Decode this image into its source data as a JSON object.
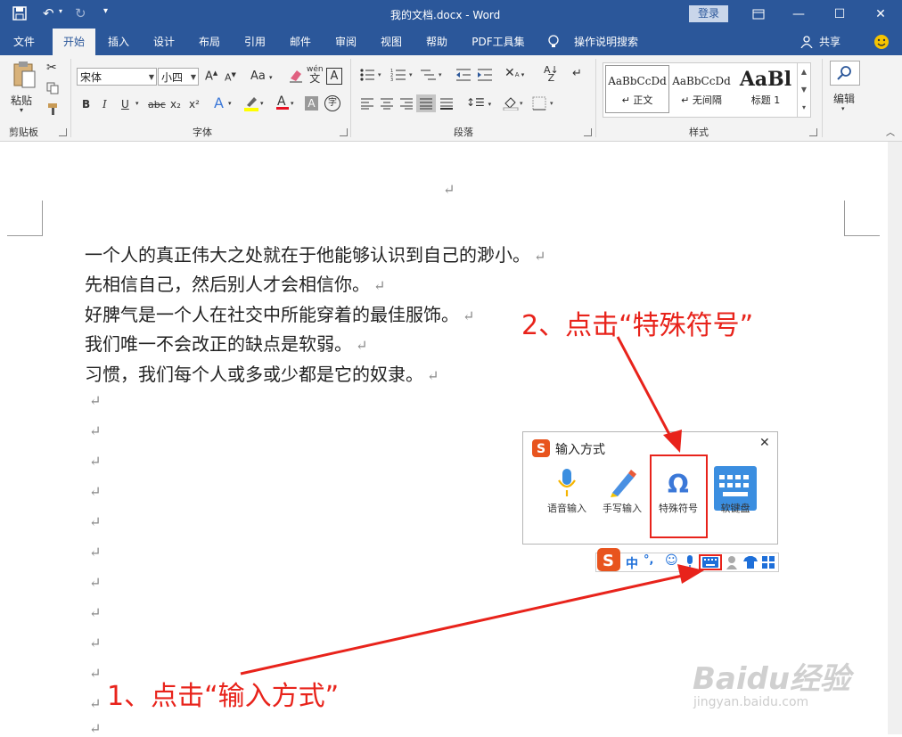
{
  "window": {
    "title": "我的文档.docx  -  Word",
    "login_label": "登录"
  },
  "menu_tabs": [
    "文件",
    "开始",
    "插入",
    "设计",
    "布局",
    "引用",
    "邮件",
    "审阅",
    "视图",
    "帮助",
    "PDF工具集",
    "操作说明搜索"
  ],
  "share_label": "共享",
  "ribbon": {
    "clipboard": {
      "paste_label": "粘贴",
      "group_label": "剪贴板"
    },
    "font": {
      "font_name": "宋体",
      "font_size": "小四",
      "group_label": "字体",
      "bold": "B",
      "italic": "I",
      "underline": "U",
      "strike": "abc",
      "sub": "x₂",
      "sup": "x²",
      "grow": "A",
      "shrink": "A",
      "case": "Aa",
      "pinyin": "wén",
      "border_char": "A"
    },
    "paragraph": {
      "group_label": "段落"
    },
    "styles": {
      "group_label": "样式",
      "items": [
        {
          "preview": "AaBbCcDd",
          "name": "↵ 正文"
        },
        {
          "preview": "AaBbCcDd",
          "name": "↵ 无间隔"
        },
        {
          "preview": "AaBl",
          "name": "标题 1"
        }
      ]
    },
    "editing": {
      "label": "编辑"
    }
  },
  "document": {
    "lines": [
      "一个人的真正伟大之处就在于他能够认识到自己的渺小。",
      "先相信自己，然后别人才会相信你。",
      "好脾气是一个人在社交中所能穿着的最佳服饰。",
      "我们唯一不会改正的缺点是软弱。",
      "习惯，我们每个人或多或少都是它的奴隶。"
    ],
    "para_mark": "↵"
  },
  "ime_popup": {
    "title": "输入方式",
    "items": [
      {
        "label": "语音输入"
      },
      {
        "label": "手写输入"
      },
      {
        "label": "特殊符号"
      },
      {
        "label": "软键盘"
      }
    ],
    "bar_lang": "中"
  },
  "annotations": {
    "step1": "1、点击“输入方式”",
    "step2": "2、点击“特殊符号”"
  },
  "watermark": {
    "brand": "Baidu经验",
    "url": "jingyan.baidu.com"
  },
  "colors": {
    "word_blue": "#2b579a",
    "annotation_red": "#e8231b",
    "sogou_orange": "#e8541e"
  }
}
